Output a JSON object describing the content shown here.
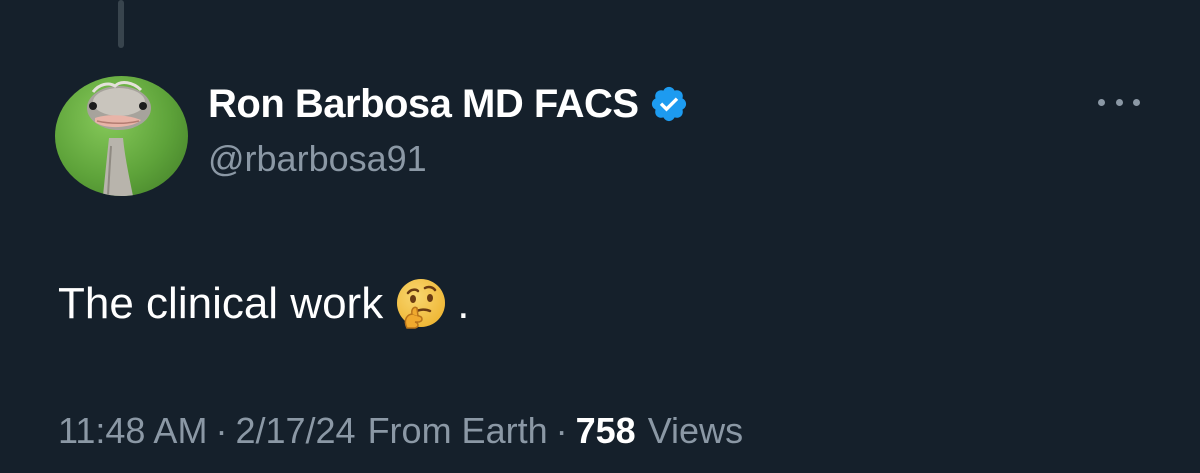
{
  "tweet": {
    "author": {
      "display_name": "Ron Barbosa MD FACS",
      "handle": "@rbarbosa91",
      "verified": true,
      "avatar_icon": "ostrich-avatar-icon",
      "verified_icon": "verified-badge-icon"
    },
    "text": "The clinical work",
    "text_emoji": "thinking-face-emoji",
    "text_suffix": ".",
    "meta": {
      "time": "11:48 AM",
      "separator": "·",
      "date": "2/17/24",
      "location": "From Earth",
      "views_count": "758",
      "views_label": "Views"
    },
    "more_icon": "more-options-icon"
  },
  "colors": {
    "background": "#15202b",
    "text_primary": "#ffffff",
    "text_secondary": "#8b98a5",
    "verified_blue": "#1d9bf0",
    "thread_line": "#38444d"
  }
}
